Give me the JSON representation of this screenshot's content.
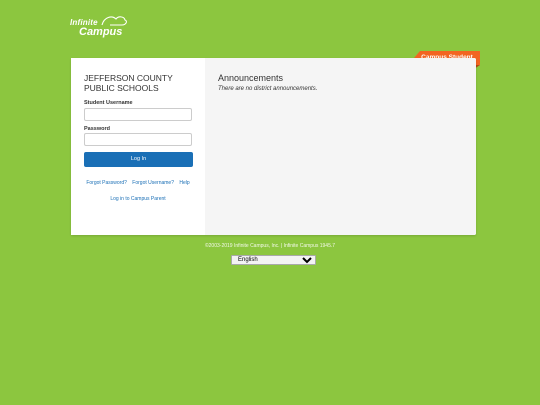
{
  "brand": {
    "logo_line1": "Infinite",
    "logo_line2": "Campus",
    "logo_icon": "cloud-swoosh-icon"
  },
  "ribbon": {
    "label": "Campus Student",
    "color": "#f26522"
  },
  "login": {
    "district_name": "JEFFERSON COUNTY PUBLIC SCHOOLS",
    "username_label": "Student Username",
    "username_value": "",
    "password_label": "Password",
    "password_value": "",
    "login_button": "Log In",
    "forgot_password": "Forgot Password?",
    "forgot_username": "Forgot Username?",
    "help": "Help",
    "parent_link": "Log in to Campus Parent"
  },
  "announcements": {
    "title": "Announcements",
    "text": "There are no district announcements."
  },
  "footer": {
    "copyright": "©2003-2019 Infinite Campus, Inc. | Infinite Campus 1945.7",
    "language_selected": "English",
    "language_options": [
      "English"
    ]
  },
  "colors": {
    "background": "#8cc63f",
    "primary_button": "#1a6fb6",
    "link": "#1a6fb6",
    "accent": "#f26522"
  }
}
